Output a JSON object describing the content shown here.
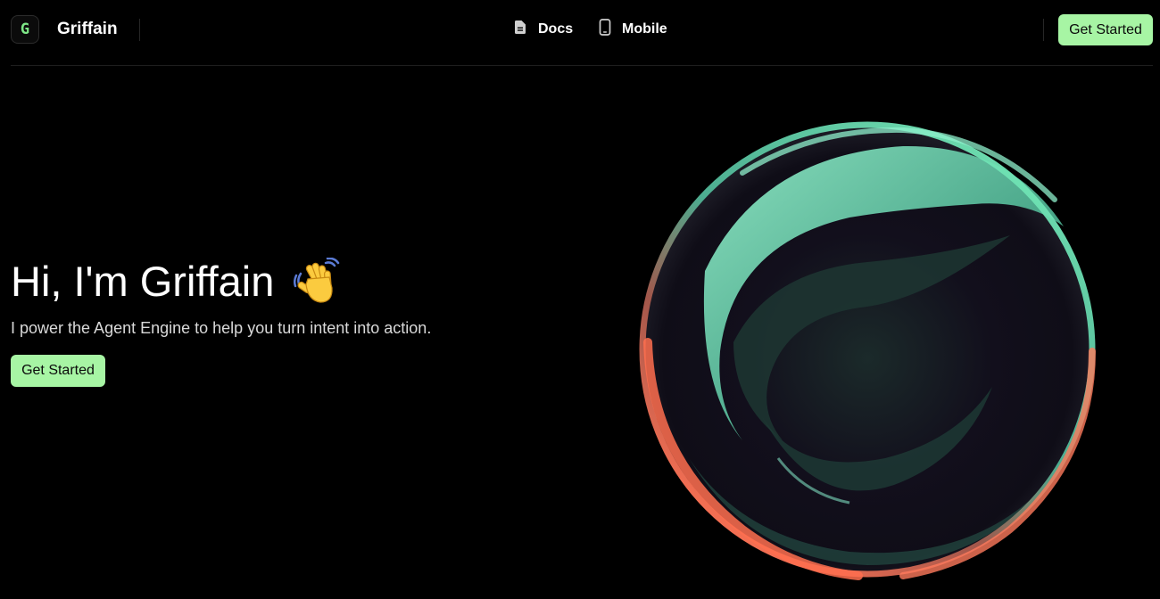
{
  "header": {
    "logo_letter": "G",
    "brand": "Griffain",
    "links": [
      {
        "label": "Docs",
        "icon": "document-icon"
      },
      {
        "label": "Mobile",
        "icon": "mobile-phone-icon"
      }
    ],
    "cta_label": "Get Started"
  },
  "hero": {
    "title": "Hi, I'm Griffain",
    "emoji": "waving-hand",
    "subtitle": "I power the Agent Engine to help you turn intent into action.",
    "cta_label": "Get Started"
  },
  "colors": {
    "background": "#000000",
    "accent_green": "#a7f5a4",
    "logo_green": "#7ee787",
    "orb_teal": "#6fe3b4",
    "orb_coral": "#ff7355"
  }
}
